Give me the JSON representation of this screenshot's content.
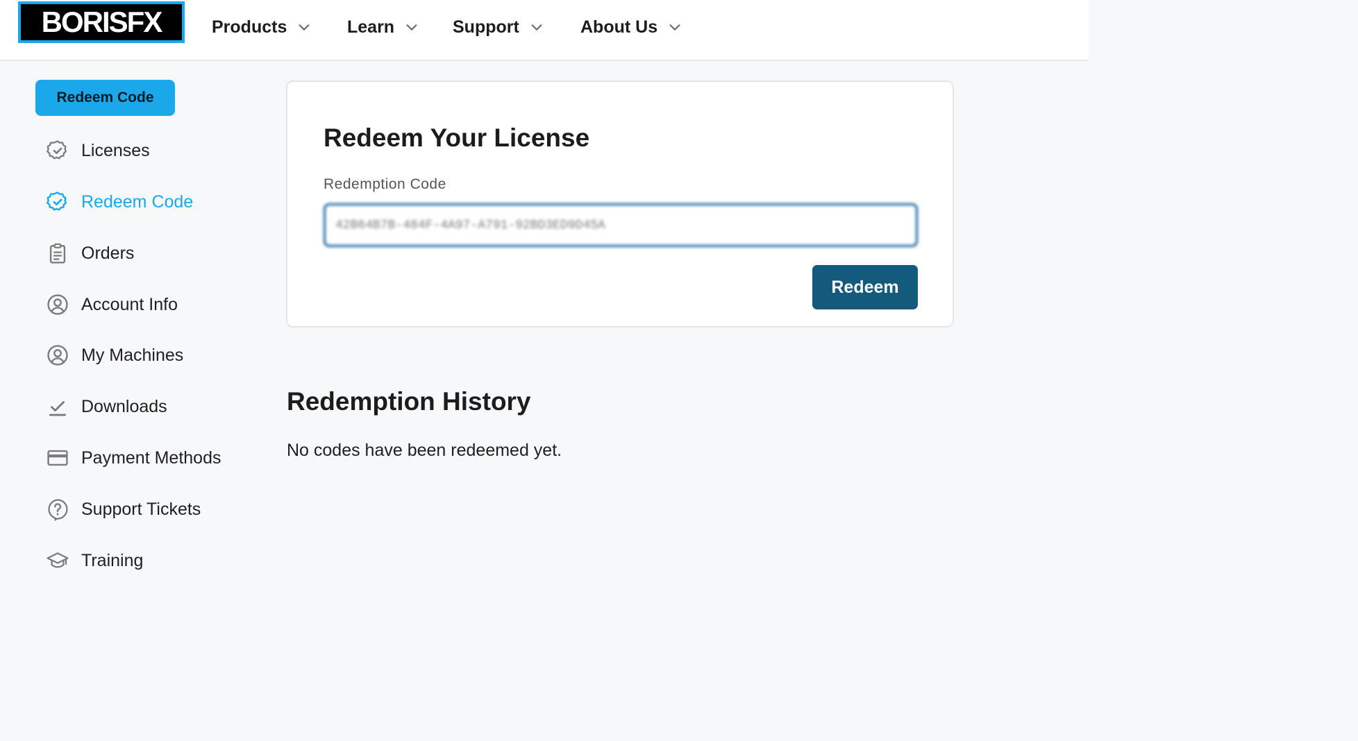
{
  "brand": {
    "logo_text": "BORISFX",
    "accent": "#1aa8ea",
    "primary": "#135a7c"
  },
  "nav": {
    "items": [
      {
        "label": "Products",
        "icon": "chevron-down-icon"
      },
      {
        "label": "Learn",
        "icon": "chevron-down-icon"
      },
      {
        "label": "Support",
        "icon": "chevron-down-icon"
      },
      {
        "label": "About Us",
        "icon": "chevron-down-icon"
      }
    ]
  },
  "sidebar": {
    "cta_label": "Redeem Code",
    "items": [
      {
        "label": "Licenses",
        "icon": "badge-check-icon"
      },
      {
        "label": "Redeem Code",
        "icon": "badge-check-icon",
        "active": true
      },
      {
        "label": "Orders",
        "icon": "clipboard-icon"
      },
      {
        "label": "Account Info",
        "icon": "user-circle-icon"
      },
      {
        "label": "My Machines",
        "icon": "user-circle-icon"
      },
      {
        "label": "Downloads",
        "icon": "download-check-icon"
      },
      {
        "label": "Payment Methods",
        "icon": "credit-card-icon"
      },
      {
        "label": "Support Tickets",
        "icon": "question-bubble-icon"
      },
      {
        "label": "Training",
        "icon": "graduation-cap-icon"
      }
    ]
  },
  "redeem": {
    "title": "Redeem Your License",
    "field_label": "Redemption Code",
    "code_value": "42B64B7B-484F-4A97-A791-92BD3ED9D45A",
    "button_label": "Redeem"
  },
  "history": {
    "title": "Redemption History",
    "empty_message": "No codes have been redeemed yet."
  }
}
